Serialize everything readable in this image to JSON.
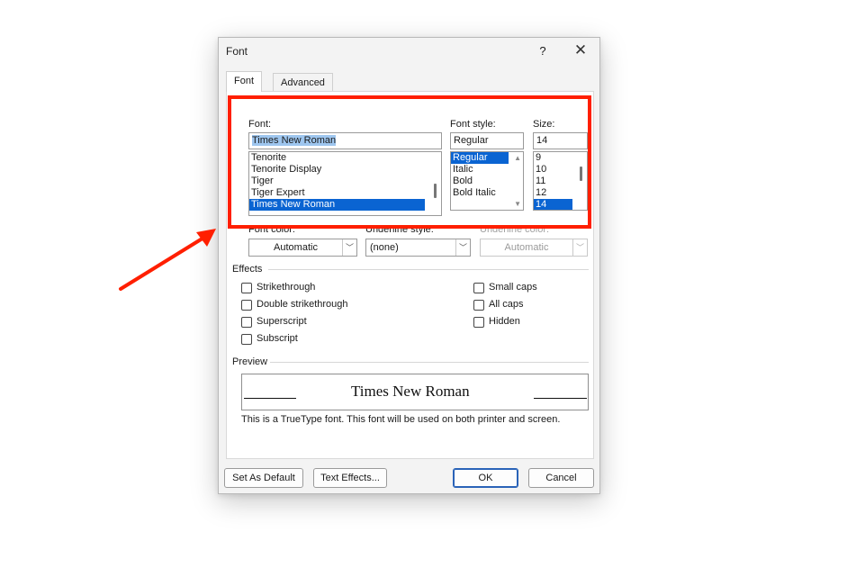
{
  "dialog": {
    "title": "Font",
    "help_label": "?",
    "close_label": "✕"
  },
  "tabs": [
    {
      "label": "Font",
      "key_letter": "n",
      "active": true
    },
    {
      "label": "Advanced",
      "key_letter": "v",
      "active": false
    }
  ],
  "font": {
    "label": "Font:",
    "value": "Times New Roman",
    "options": [
      "Tenorite",
      "Tenorite Display",
      "Tiger",
      "Tiger Expert",
      "Times New Roman"
    ],
    "selected": "Times New Roman"
  },
  "font_style": {
    "label": "Font style:",
    "value": "Regular",
    "options": [
      "Regular",
      "Italic",
      "Bold",
      "Bold Italic"
    ],
    "selected": "Regular",
    "scroll_up": "▲",
    "scroll_down": "▼"
  },
  "size": {
    "label": "Size:",
    "value": "14",
    "options": [
      "9",
      "10",
      "11",
      "12",
      "14"
    ],
    "selected": "14"
  },
  "font_color": {
    "label": "Font color:",
    "value": "Automatic",
    "arrow": "﹀"
  },
  "underline_style": {
    "label": "Underline style:",
    "value": "(none)",
    "arrow": "﹀"
  },
  "underline_color": {
    "label": "Underline color:",
    "value": "Automatic",
    "arrow": "﹀",
    "disabled": true
  },
  "effects": {
    "title": "Effects",
    "left": [
      {
        "label": "Strikethrough",
        "checked": false
      },
      {
        "label": "Double strikethrough",
        "checked": false
      },
      {
        "label": "Superscript",
        "checked": false
      },
      {
        "label": "Subscript",
        "checked": false
      }
    ],
    "right": [
      {
        "label": "Small caps",
        "checked": false
      },
      {
        "label": "All caps",
        "checked": false
      },
      {
        "label": "Hidden",
        "checked": false
      }
    ]
  },
  "preview": {
    "title": "Preview",
    "sample": "Times New Roman",
    "note": "This is a TrueType font. This font will be used on both printer and screen."
  },
  "buttons": {
    "set_default": "Set As Default",
    "text_effects": "Text Effects...",
    "ok": "OK",
    "cancel": "Cancel"
  },
  "annotation": {
    "highlight_color": "#ff1f00",
    "arrow_color": "#ff1f00"
  }
}
